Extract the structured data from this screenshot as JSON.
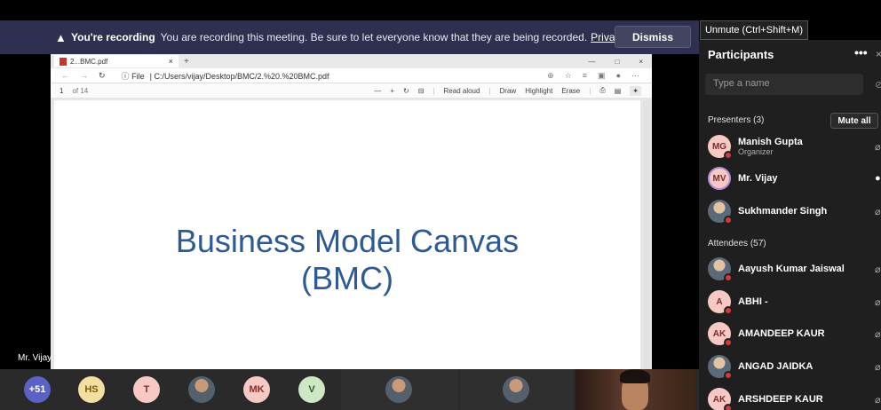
{
  "banner": {
    "title": "You're recording",
    "message": "You are recording this meeting. Be sure to let everyone know that they are being recorded.",
    "link": "Privacy policy",
    "dismiss": "Dismiss"
  },
  "tooltip": "Unmute (Ctrl+Shift+M)",
  "browser": {
    "tab_title": "2...BMC.pdf",
    "file_label": "File",
    "url": "C:/Users/vijay/Desktop/BMC/2.%20.%20BMC.pdf",
    "page": "1",
    "page_count": "of 14",
    "tools": [
      "Read aloud",
      "Draw",
      "Highlight",
      "Erase"
    ]
  },
  "slide": {
    "line1": "Business Model Canvas",
    "line2": "(BMC)"
  },
  "presenter_label": "Mr. Vijay",
  "panel": {
    "title": "Participants",
    "search_placeholder": "Type a name",
    "presenters_header": "Presenters (3)",
    "mute_all": "Mute all",
    "attendees_header": "Attendees (57)",
    "presenters": [
      {
        "initials": "MG",
        "name": "Manish Gupta",
        "role": "Organizer"
      },
      {
        "initials": "MV",
        "name": "Mr. Vijay",
        "role": ""
      },
      {
        "initials": "",
        "name": "Sukhmander Singh",
        "role": ""
      }
    ],
    "attendees": [
      {
        "initials": "",
        "name": "Aayush Kumar Jaiswal"
      },
      {
        "initials": "A",
        "name": "ABHI -"
      },
      {
        "initials": "AK",
        "name": "AMANDEEP KAUR"
      },
      {
        "initials": "",
        "name": "ANGAD JAIDKA"
      },
      {
        "initials": "AK",
        "name": "ARSHDEEP KAUR"
      }
    ]
  },
  "strip": {
    "overflow": "+51",
    "avatars": [
      "HS",
      "T",
      "",
      "MK",
      "V"
    ]
  }
}
